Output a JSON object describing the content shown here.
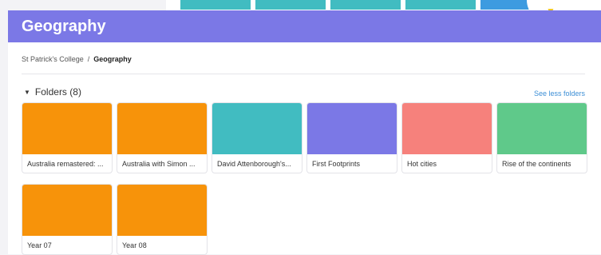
{
  "header": {
    "title": "Geography"
  },
  "breadcrumb": {
    "root": "St Patrick's College",
    "separator": "/",
    "current": "Geography"
  },
  "folders": {
    "heading": "Folders (8)",
    "toggle_label": "See less folders",
    "items": [
      {
        "label": "Australia remastered: ...",
        "color": "#f7930a"
      },
      {
        "label": "Australia with Simon ...",
        "color": "#f7930a"
      },
      {
        "label": "David Attenborough's...",
        "color": "#41bcc1"
      },
      {
        "label": "First Footprints",
        "color": "#7b78e6"
      },
      {
        "label": "Hot cities",
        "color": "#f6817c"
      },
      {
        "label": "Rise of the continents",
        "color": "#5fc98a"
      },
      {
        "label": "Year 07",
        "color": "#f7930a"
      },
      {
        "label": "Year 08",
        "color": "#f7930a"
      }
    ]
  },
  "colors": {
    "header": "#7b78e6",
    "link": "#3d8fd6",
    "background_tiles": [
      "#41bcc1",
      "#41bcc1",
      "#41bcc1",
      "#41bcc1",
      "#3d9be0"
    ]
  }
}
